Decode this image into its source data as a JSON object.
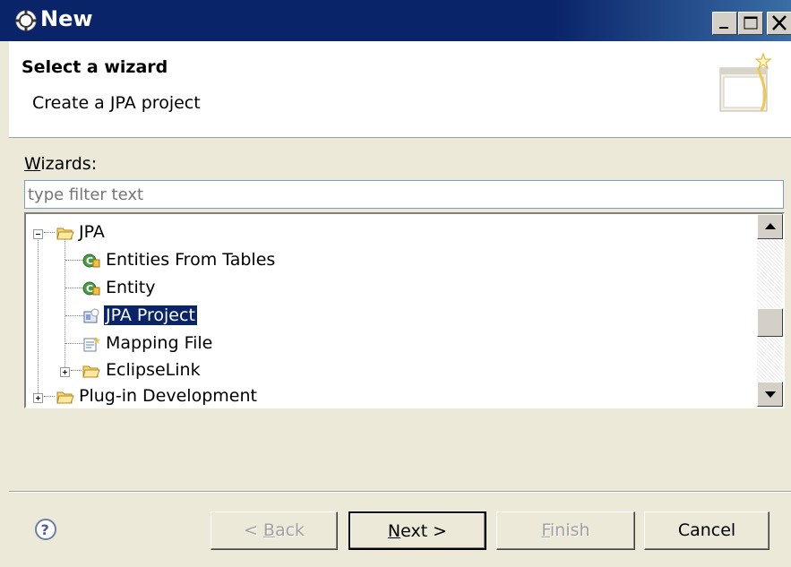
{
  "window": {
    "title": "New",
    "controls": {
      "minimize": "minimize",
      "maximize": "maximize",
      "close": "close"
    }
  },
  "banner": {
    "title": "Select a wizard",
    "description": "Create a JPA project",
    "icon": "wizard-banner-icon"
  },
  "wizards": {
    "label_prefix": "",
    "label_mnemonic": "W",
    "label_rest": "izards:",
    "filter_placeholder": "type filter text",
    "filter_value": ""
  },
  "tree": {
    "items": [
      {
        "label": "JPA",
        "icon": "folder-open-icon",
        "expanded": true
      },
      {
        "label": "Entities From Tables",
        "icon": "entity-icon"
      },
      {
        "label": "Entity",
        "icon": "entity-icon"
      },
      {
        "label": "JPA Project",
        "icon": "jpa-project-icon",
        "selected": true
      },
      {
        "label": "Mapping File",
        "icon": "mapping-file-icon"
      },
      {
        "label": "EclipseLink",
        "icon": "folder-icon",
        "expanded": false
      },
      {
        "label": "Plug-in Development",
        "icon": "folder-icon",
        "expanded": false
      }
    ]
  },
  "buttons": {
    "back_pre": "< ",
    "back_mn": "B",
    "back_rest": "ack",
    "next_mn": "N",
    "next_rest": "ext >",
    "finish_mn": "F",
    "finish_rest": "inish",
    "cancel": "Cancel"
  },
  "colors": {
    "titlebar": "#0a246a",
    "selection": "#0a246a",
    "dialog_bg": "#ece9d8"
  }
}
